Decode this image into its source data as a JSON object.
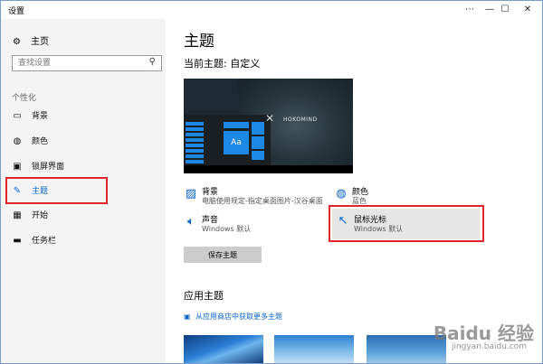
{
  "window": {
    "title": "设置",
    "controls": [
      "⋯",
      "—",
      "☐",
      "✕"
    ]
  },
  "sidebar": {
    "home_label": "主页",
    "search_placeholder": "查找设置",
    "section_label": "个性化",
    "items": [
      {
        "label": "背景",
        "icon": "image-icon"
      },
      {
        "label": "颜色",
        "icon": "palette-icon"
      },
      {
        "label": "锁屏界面",
        "icon": "lockscreen-icon"
      },
      {
        "label": "主题",
        "icon": "brush-icon",
        "active": true
      },
      {
        "label": "开始",
        "icon": "start-icon"
      },
      {
        "label": "任务栏",
        "icon": "taskbar-icon"
      }
    ]
  },
  "main": {
    "title": "主题",
    "current_theme": "当前主题: 自定义",
    "preview": {
      "tile_label": "Aa",
      "logo_text": "HOKOMIND"
    },
    "options": [
      {
        "title": "背景",
        "subtitle": "电脑使用规定-指定桌面图片-汉谷桌面"
      },
      {
        "title": "颜色",
        "subtitle": "蓝色"
      },
      {
        "title": "声音",
        "subtitle": "Windows 默认"
      },
      {
        "title": "鼠标光标",
        "subtitle": "Windows 默认"
      }
    ],
    "save_button": "保存主题",
    "apply_title": "应用主题",
    "store_link": "从应用商店中获取更多主题"
  },
  "watermark": {
    "brand": "Baidu 经验",
    "url": "jingyan.baidu.com"
  },
  "colors": {
    "accent": "#0a64c8",
    "highlight_box": "#e0252b"
  }
}
